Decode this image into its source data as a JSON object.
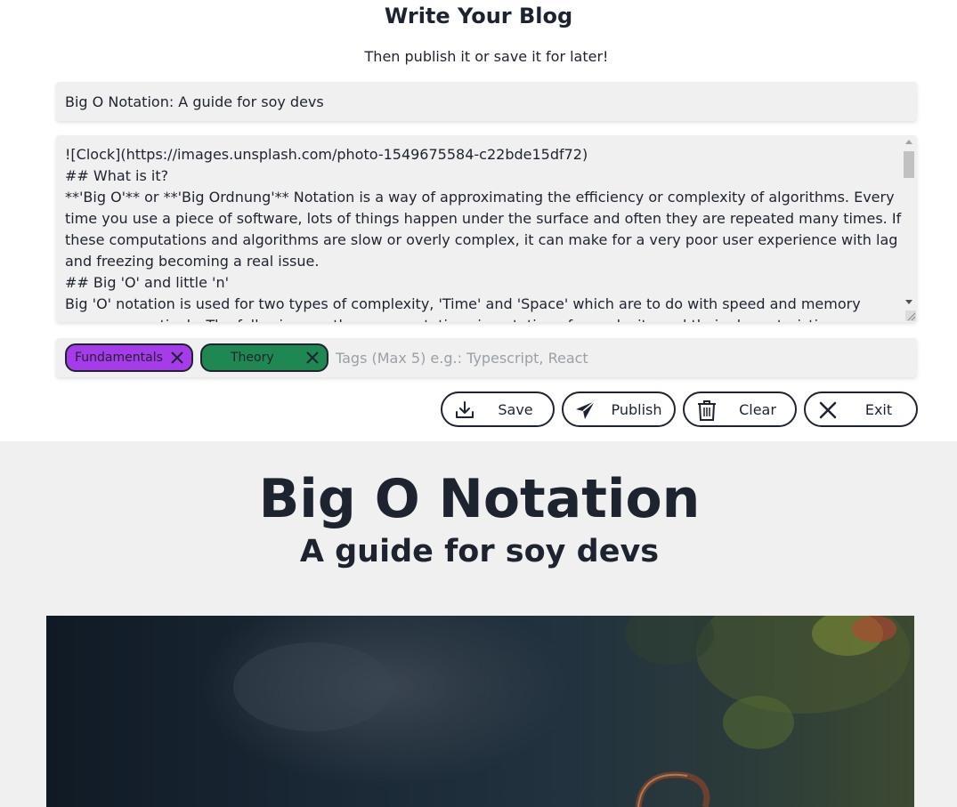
{
  "editor": {
    "heading": "Write Your Blog",
    "subheading": "Then publish it or save it for later!",
    "title_value": "Big O Notation: A guide for soy devs",
    "content_lines": "![Clock](https://images.unsplash.com/photo-1549675584-c22bde15df72)\n## What is it?\n**'Big O'** or **'Big Ordnung'** Notation is a way of approximating the efficiency or complexity of algorithms. Every time you use a piece of software, lots of things happen under the surface and often they are repeated many times. If these computations and algorithms are slow or overly complex, it can make for a very poor user experience with lag and freezing becoming a real issue.\n## Big 'O' and little 'n'\nBig 'O' notation is used for two types of complexity, 'Time' and 'Space' which are to do with speed and memory usage respectively. The following are the representations in notation of complexity and their characteristics.",
    "tags": [
      {
        "label": "Fundamentals",
        "color": "#a63bea"
      },
      {
        "label": "Theory",
        "color": "#1e8752"
      }
    ],
    "tag_placeholder": "Tags (Max 5) e.g.: Typescript, React",
    "buttons": {
      "save": "Save",
      "publish": "Publish",
      "clear": "Clear",
      "exit": "Exit"
    }
  },
  "preview": {
    "title": "Big O Notation",
    "subtitle": "A guide for soy devs",
    "image_alt": "Clock"
  },
  "icons": {
    "save": "download-icon",
    "publish": "paper-plane-icon",
    "clear": "trash-icon",
    "exit": "close-icon",
    "tag_remove": "close-icon"
  }
}
